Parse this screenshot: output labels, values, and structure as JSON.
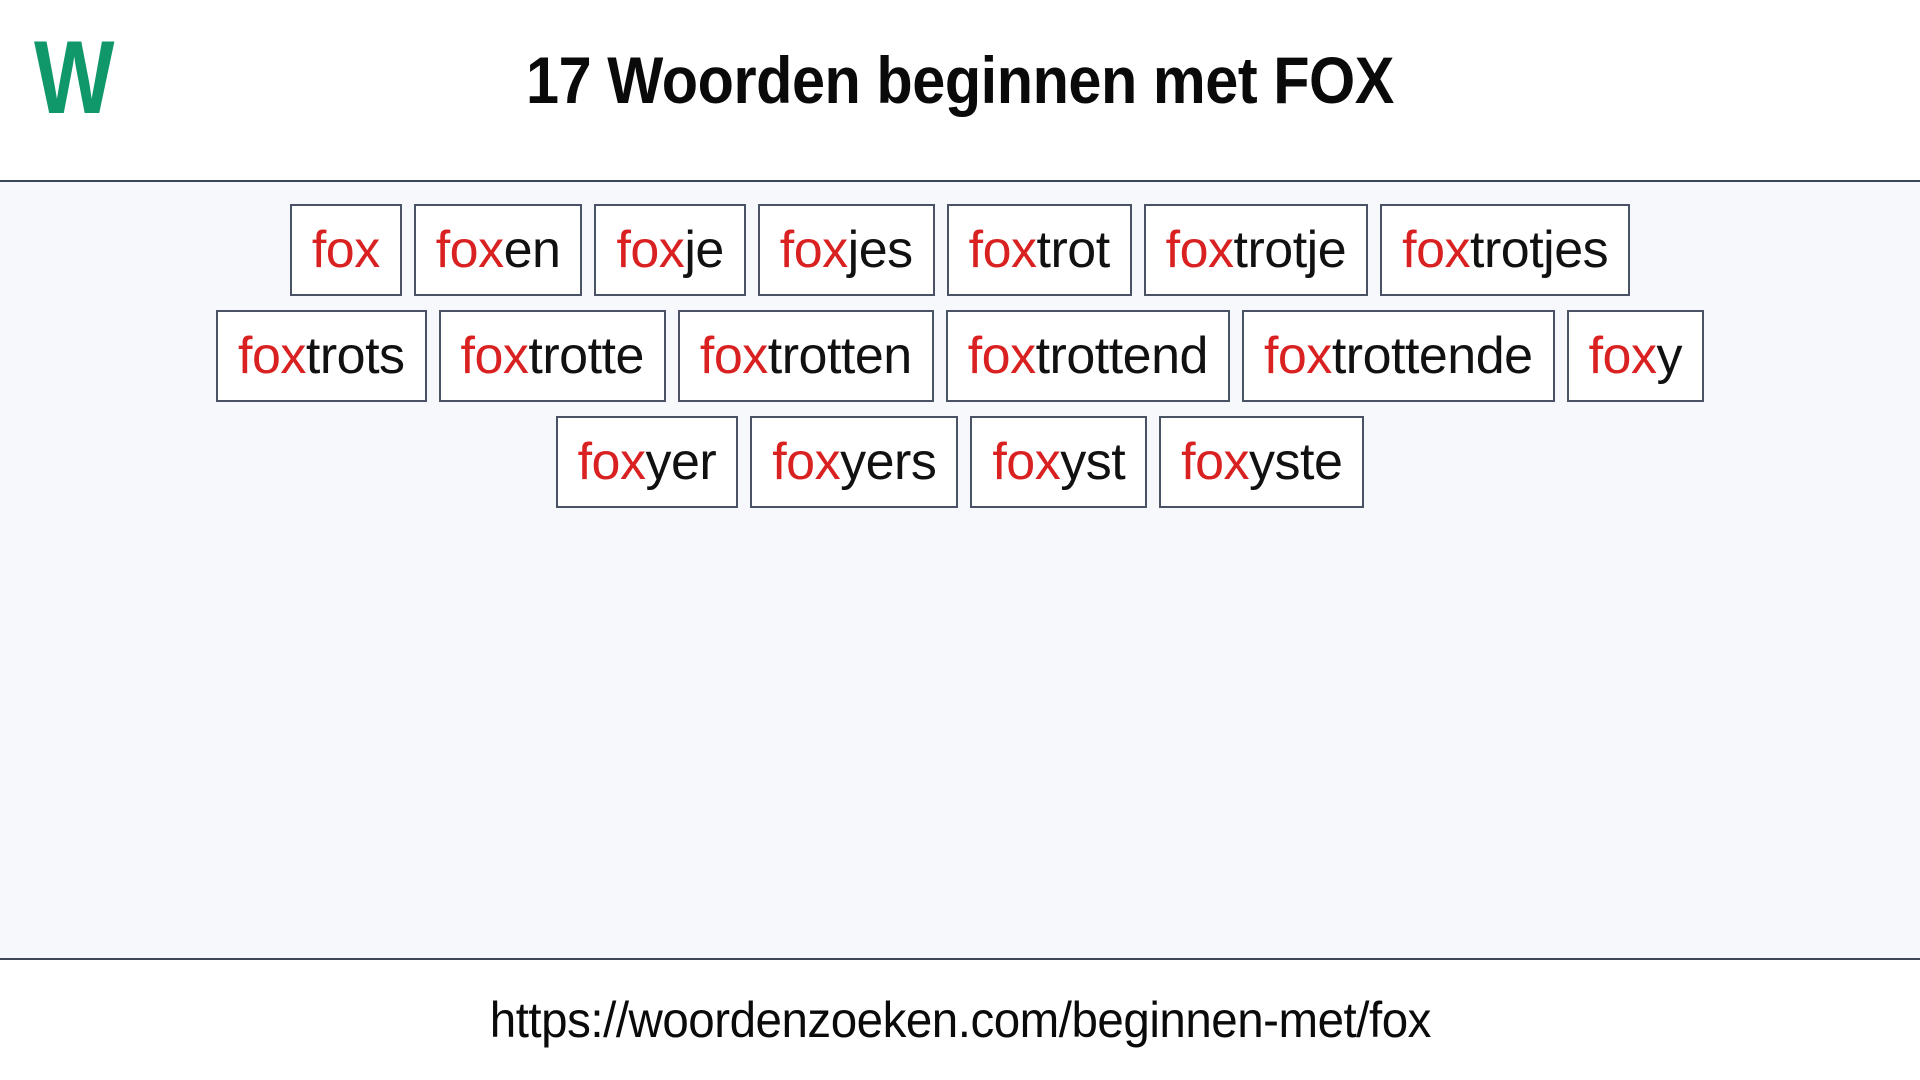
{
  "header": {
    "logo_text": "W",
    "logo_color": "#10976a",
    "title": "17 Woorden beginnen met FOX"
  },
  "theme": {
    "prefix_color": "#d92121",
    "suffix_color": "#111111",
    "box_border_color": "#4a5366",
    "main_background": "#f6f8fb",
    "divider_color": "#3d4758"
  },
  "main": {
    "prefix": "fox",
    "word_count": 17,
    "rows": [
      {
        "words": [
          {
            "prefix": "fox",
            "suffix": ""
          },
          {
            "prefix": "fox",
            "suffix": "en"
          },
          {
            "prefix": "fox",
            "suffix": "je"
          },
          {
            "prefix": "fox",
            "suffix": "jes"
          },
          {
            "prefix": "fox",
            "suffix": "trot"
          },
          {
            "prefix": "fox",
            "suffix": "trotje"
          },
          {
            "prefix": "fox",
            "suffix": "trotjes"
          }
        ]
      },
      {
        "words": [
          {
            "prefix": "fox",
            "suffix": "trots"
          },
          {
            "prefix": "fox",
            "suffix": "trotte"
          },
          {
            "prefix": "fox",
            "suffix": "trotten"
          },
          {
            "prefix": "fox",
            "suffix": "trottend"
          },
          {
            "prefix": "fox",
            "suffix": "trottende"
          },
          {
            "prefix": "fox",
            "suffix": "y"
          }
        ]
      },
      {
        "words": [
          {
            "prefix": "fox",
            "suffix": "yer"
          },
          {
            "prefix": "fox",
            "suffix": "yers"
          },
          {
            "prefix": "fox",
            "suffix": "yst"
          },
          {
            "prefix": "fox",
            "suffix": "yste"
          }
        ]
      }
    ]
  },
  "footer": {
    "url": "https://woordenzoeken.com/beginnen-met/fox"
  }
}
